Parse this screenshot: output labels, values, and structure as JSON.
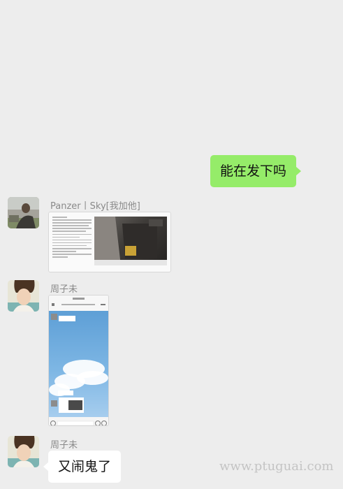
{
  "messages": [
    {
      "direction": "out",
      "text": "能在发下吗"
    },
    {
      "direction": "in",
      "sender": "Panzer丨Sky[我加他]",
      "type": "image",
      "image_desc": "document-screenshot"
    },
    {
      "direction": "in",
      "sender": "周子未",
      "type": "image",
      "image_desc": "phone-chat-screenshot"
    },
    {
      "direction": "in",
      "sender": "周子未",
      "text": "又闹鬼了"
    }
  ],
  "watermark": "www.ptuguai.com",
  "colors": {
    "background": "#ededed",
    "outgoing_bubble": "#95ec69",
    "incoming_bubble": "#ffffff",
    "sender_name": "#8a8a8a"
  }
}
